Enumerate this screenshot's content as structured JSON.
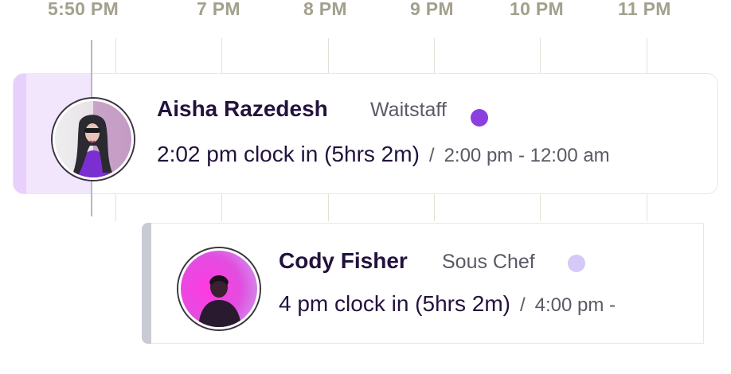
{
  "timeline": {
    "current_time_label": "5:50 PM",
    "hour_labels": [
      "7 PM",
      "8 PM",
      "9 PM",
      "10 PM",
      "11 PM"
    ]
  },
  "shifts": [
    {
      "name": "Aisha Razedesh",
      "role": "Waitstaff",
      "clock_in": "2:02 pm clock in (5hrs 2m)",
      "separator": "/",
      "scheduled": "2:00 pm - 12:00 am",
      "status_color": "#8b3fe0",
      "accent_color": "#e7d0fb"
    },
    {
      "name": "Cody Fisher",
      "role": "Sous Chef",
      "clock_in": "4 pm clock in (5hrs 2m)",
      "separator": "/",
      "scheduled": "4:00 pm -",
      "status_color": "#d4c9f7",
      "accent_color": "#c9cbd3"
    }
  ]
}
